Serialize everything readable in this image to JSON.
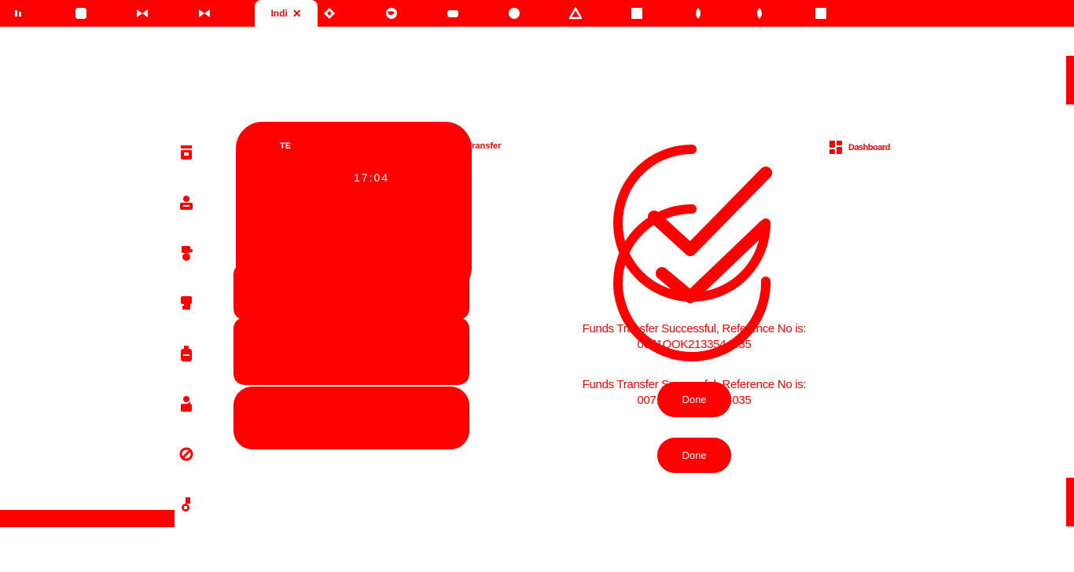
{
  "browser": {
    "tabs": [
      {
        "icon": "app-icon"
      },
      {
        "icon": "square-icon"
      },
      {
        "icon": "bowtie-icon"
      },
      {
        "icon": "bowtie-icon"
      },
      {
        "icon": "diamond-icon"
      },
      {
        "icon": "globe-icon"
      },
      {
        "icon": "rounded-rect-icon"
      },
      {
        "icon": "circle-icon"
      },
      {
        "icon": "triangle-icon"
      },
      {
        "icon": "square-icon"
      },
      {
        "icon": "leaf-icon"
      },
      {
        "icon": "leaf-icon"
      },
      {
        "icon": "square-icon"
      }
    ],
    "active_tab": {
      "label": "Indi",
      "close": "✕"
    }
  },
  "sidebar": {
    "items": [
      {
        "icon": "accounts-icon"
      },
      {
        "icon": "transfer-icon"
      },
      {
        "icon": "payments-icon"
      },
      {
        "icon": "cards-icon"
      },
      {
        "icon": "bills-icon"
      },
      {
        "icon": "profile-icon"
      },
      {
        "icon": "settings-icon"
      },
      {
        "icon": "logout-icon"
      }
    ]
  },
  "device_preview": {
    "time": "17:04",
    "right_label": "Transfer",
    "left_label": "TE"
  },
  "header": {
    "dashboard_label": "Dashboard"
  },
  "result": {
    "message_lines_1": [
      "Funds Transfer Successful, Reference No is:",
      "0071OOK2133544035"
    ],
    "message_lines_2": [
      "Funds Transfer Successful, Reference No is:",
      "0071OOK2133544035"
    ],
    "buttons": {
      "primary_label": "Done",
      "secondary_label": "Done"
    }
  },
  "colors": {
    "accent": "#ff0000",
    "background": "#ffffff"
  }
}
